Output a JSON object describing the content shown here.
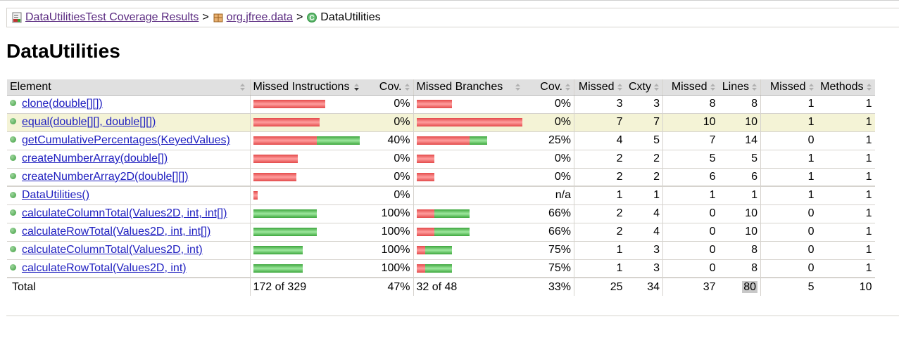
{
  "breadcrumb": {
    "report": "DataUtilitiesTest Coverage Results",
    "package": "org.jfree.data",
    "class": "DataUtilities"
  },
  "page_title": "DataUtilities",
  "table": {
    "headers": {
      "element": "Element",
      "missed_instructions": "Missed Instructions",
      "cov": "Cov.",
      "missed_branches": "Missed Branches",
      "cov2": "Cov.",
      "missed_cxty": "Missed",
      "cxty": "Cxty",
      "missed_lines": "Missed",
      "lines": "Lines",
      "missed_methods": "Missed",
      "methods": "Methods"
    },
    "rows": [
      {
        "name": "clone(double[][])",
        "instr_missed_frac": 1.0,
        "instr_cov_frac": 0.0,
        "instr_cov": "0%",
        "br_missed_frac": 0.333,
        "br_cov_frac": 0.0,
        "br_cov": "0%",
        "missed_cxty": "3",
        "cxty": "3",
        "missed_lines": "8",
        "lines": "8",
        "missed_methods": "1",
        "methods": "1"
      },
      {
        "name": "equal(double[][], double[][])",
        "instr_missed_frac": 0.92,
        "instr_cov_frac": 0.0,
        "instr_cov": "0%",
        "br_missed_frac": 1.0,
        "br_cov_frac": 0.0,
        "br_cov": "0%",
        "missed_cxty": "7",
        "cxty": "7",
        "missed_lines": "10",
        "lines": "10",
        "missed_methods": "1",
        "methods": "1"
      },
      {
        "name": "getCumulativePercentages(KeyedValues)",
        "instr_missed_frac": 0.88,
        "instr_cov_frac": 0.6,
        "instr_cov": "40%",
        "br_missed_frac": 0.5,
        "br_cov_frac": 0.167,
        "br_cov": "25%",
        "missed_cxty": "4",
        "cxty": "5",
        "missed_lines": "7",
        "lines": "14",
        "missed_methods": "0",
        "methods": "1"
      },
      {
        "name": "createNumberArray(double[])",
        "instr_missed_frac": 0.62,
        "instr_cov_frac": 0.0,
        "instr_cov": "0%",
        "br_missed_frac": 0.167,
        "br_cov_frac": 0.0,
        "br_cov": "0%",
        "missed_cxty": "2",
        "cxty": "2",
        "missed_lines": "5",
        "lines": "5",
        "missed_methods": "1",
        "methods": "1"
      },
      {
        "name": "createNumberArray2D(double[][])",
        "instr_missed_frac": 0.6,
        "instr_cov_frac": 0.0,
        "instr_cov": "0%",
        "br_missed_frac": 0.167,
        "br_cov_frac": 0.0,
        "br_cov": "0%",
        "missed_cxty": "2",
        "cxty": "2",
        "missed_lines": "6",
        "lines": "6",
        "missed_methods": "1",
        "methods": "1"
      },
      {
        "name": "DataUtilities()",
        "instr_missed_frac": 0.06,
        "instr_cov_frac": 0.0,
        "instr_cov": "0%",
        "br_missed_frac": 0.0,
        "br_cov_frac": 0.0,
        "br_cov": "n/a",
        "missed_cxty": "1",
        "cxty": "1",
        "missed_lines": "1",
        "lines": "1",
        "missed_methods": "1",
        "methods": "1"
      },
      {
        "name": "calculateColumnTotal(Values2D, int, int[])",
        "instr_missed_frac": 0.0,
        "instr_cov_frac": 0.88,
        "instr_cov": "100%",
        "br_missed_frac": 0.167,
        "br_cov_frac": 0.333,
        "br_cov": "66%",
        "missed_cxty": "2",
        "cxty": "4",
        "missed_lines": "0",
        "lines": "10",
        "missed_methods": "0",
        "methods": "1"
      },
      {
        "name": "calculateRowTotal(Values2D, int, int[])",
        "instr_missed_frac": 0.0,
        "instr_cov_frac": 0.88,
        "instr_cov": "100%",
        "br_missed_frac": 0.167,
        "br_cov_frac": 0.333,
        "br_cov": "66%",
        "missed_cxty": "2",
        "cxty": "4",
        "missed_lines": "0",
        "lines": "10",
        "missed_methods": "0",
        "methods": "1"
      },
      {
        "name": "calculateColumnTotal(Values2D, int)",
        "instr_missed_frac": 0.0,
        "instr_cov_frac": 0.69,
        "instr_cov": "100%",
        "br_missed_frac": 0.08,
        "br_cov_frac": 0.253,
        "br_cov": "75%",
        "missed_cxty": "1",
        "cxty": "3",
        "missed_lines": "0",
        "lines": "8",
        "missed_methods": "0",
        "methods": "1"
      },
      {
        "name": "calculateRowTotal(Values2D, int)",
        "instr_missed_frac": 0.0,
        "instr_cov_frac": 0.69,
        "instr_cov": "100%",
        "br_missed_frac": 0.08,
        "br_cov_frac": 0.253,
        "br_cov": "75%",
        "missed_cxty": "1",
        "cxty": "3",
        "missed_lines": "0",
        "lines": "8",
        "missed_methods": "0",
        "methods": "1"
      }
    ],
    "total": {
      "label": "Total",
      "instructions": "172 of 329",
      "instr_cov": "47%",
      "branches": "32 of 48",
      "br_cov": "33%",
      "missed_cxty": "25",
      "cxty": "34",
      "missed_lines": "37",
      "lines": "80",
      "missed_methods": "5",
      "methods": "10"
    }
  },
  "colors": {
    "missed": "#e34a4a",
    "covered": "#3da63d",
    "highlight_row": "#f4f3d6",
    "header_bg": "#e0e0e0",
    "link": "#2020c0"
  },
  "icons": {
    "report": "report-icon",
    "package": "package-icon",
    "class": "class-icon",
    "method": "method-dot-icon",
    "sort": "sort-icon"
  }
}
